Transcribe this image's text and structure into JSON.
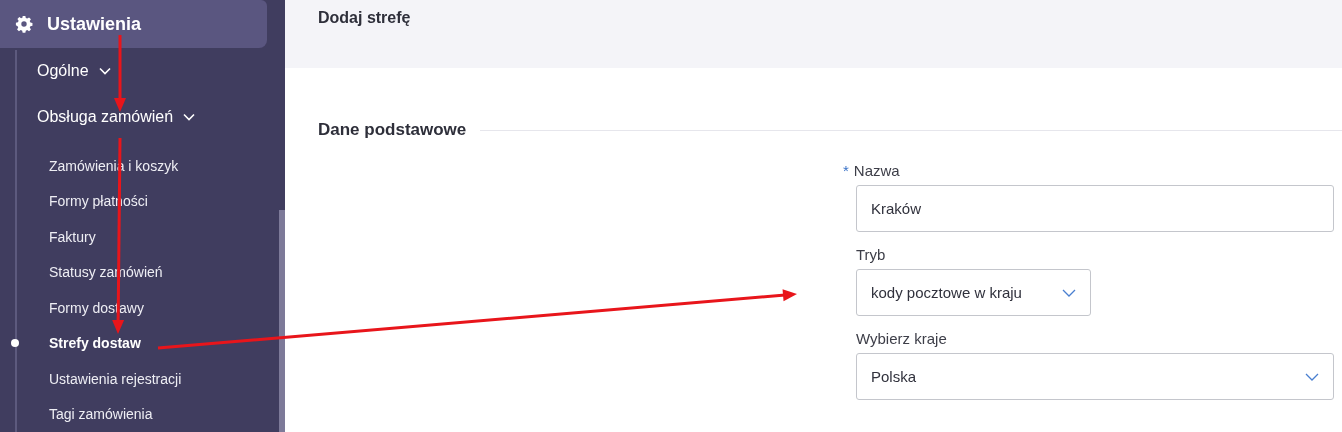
{
  "sidebar": {
    "top": {
      "label": "Ustawienia"
    },
    "groups": [
      {
        "label": "Ogólne"
      },
      {
        "label": "Obsługa zamówień",
        "children": [
          {
            "label": "Zamówienia i koszyk",
            "selected": false
          },
          {
            "label": "Formy płatności",
            "selected": false
          },
          {
            "label": "Faktury",
            "selected": false
          },
          {
            "label": "Statusy zamówień",
            "selected": false
          },
          {
            "label": "Formy dostawy",
            "selected": false
          },
          {
            "label": "Strefy dostaw",
            "selected": true
          },
          {
            "label": "Ustawienia rejestracji",
            "selected": false
          },
          {
            "label": "Tagi zamówienia",
            "selected": false
          }
        ]
      }
    ]
  },
  "header": {
    "title": "Dodaj strefę"
  },
  "section": {
    "title": "Dane podstawowe"
  },
  "fields": [
    {
      "kind": "text",
      "label": "Nazwa",
      "required_mark": "*",
      "value": "Kraków"
    },
    {
      "kind": "select",
      "label": "Tryb",
      "value": "kody pocztowe w kraju"
    },
    {
      "kind": "multiselect",
      "label": "Wybierz kraje",
      "value": "Polska"
    }
  ]
}
